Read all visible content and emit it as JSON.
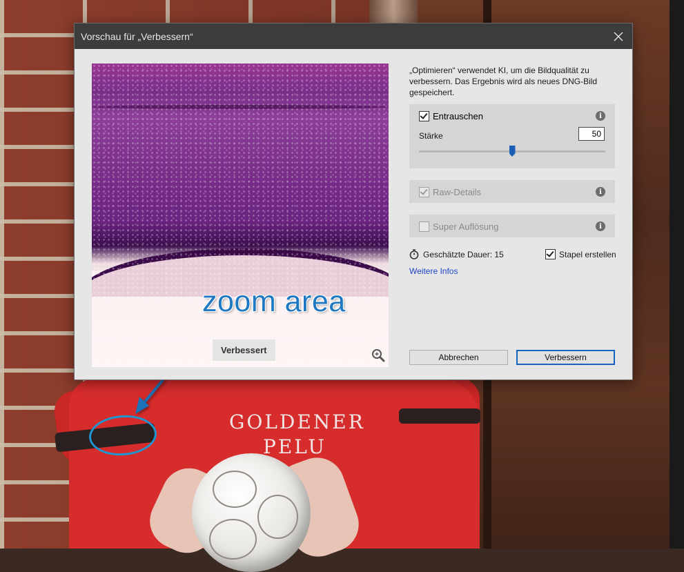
{
  "dialog": {
    "title": "Vorschau für „Verbessern“",
    "intro_text": "„Optimieren“ verwendet KI, um die Bildqualität zu verbessern. Das Ergebnis wird als neues DNG-Bild gespeichert.",
    "preview_label": "Verbessert",
    "options": {
      "entrauschen": {
        "label": "Entrauschen",
        "checked": true,
        "enabled": true
      },
      "staerke_label": "Stärke",
      "staerke_value": "50",
      "staerke_fraction": 0.5,
      "raw_details": {
        "label": "Raw-Details",
        "checked": true,
        "enabled": false
      },
      "super_aufloesung": {
        "label": "Super Auflösung",
        "checked": false,
        "enabled": false
      }
    },
    "duration_text": "Geschätzte Dauer: 15",
    "stapel_label": "Stapel erstellen",
    "stapel_checked": true,
    "more_info_link": "Weitere Infos",
    "buttons": {
      "cancel": "Abbrechen",
      "ok": "Verbessern"
    }
  },
  "annotation": {
    "label": "zoom area",
    "color": "#1e96d2"
  },
  "background": {
    "shirt_text_line1": "GOLDENER",
    "shirt_text_line2": "PELU"
  },
  "icons": {
    "close": "close-icon",
    "info": "info-icon",
    "zoom": "magnifier-icon",
    "timer": "stopwatch-icon"
  }
}
